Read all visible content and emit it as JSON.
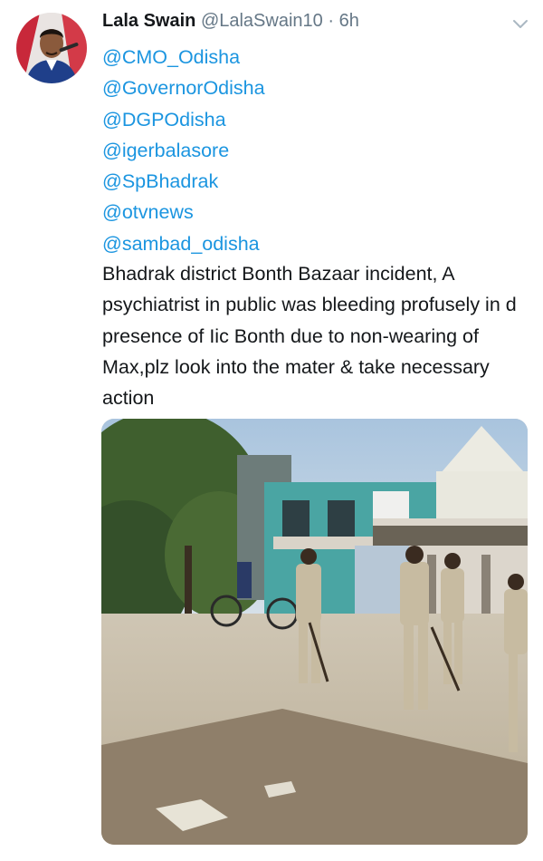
{
  "tweet": {
    "author_name": "Lala Swain",
    "author_handle": "@LalaSwain10",
    "separator": "·",
    "time": "6h",
    "mentions": [
      "@CMO_Odisha",
      "@GovernorOdisha",
      "@DGPOdisha",
      "@igerbalasore",
      "@SpBhadrak",
      "@otvnews",
      "@sambad_odisha"
    ],
    "text": "Bhadrak district Bonth Bazaar incident, A psychiatrist in public was bleeding profusely in d presence of Iic Bonth due to non-wearing of Max,plz look into the mater & take necessary action"
  },
  "icons": {
    "menu": "chevron-down-icon",
    "avatar": "avatar"
  },
  "colors": {
    "link": "#1b95e0",
    "name": "#14171a",
    "meta": "#657786"
  }
}
